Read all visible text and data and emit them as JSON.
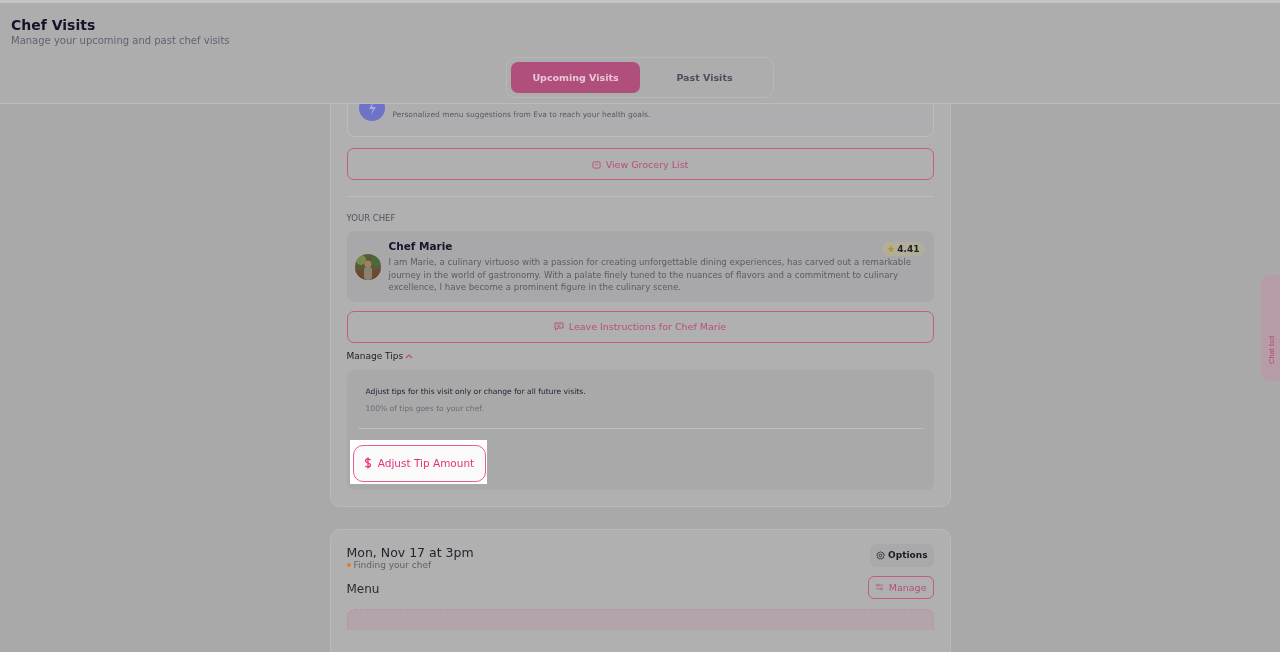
{
  "header": {
    "title": "Chef Visits",
    "subtitle": "Manage your upcoming and past chef visits"
  },
  "tabs": [
    {
      "label": "Upcoming Visits",
      "selected": true
    },
    {
      "label": "Past Visits",
      "selected": false
    }
  ],
  "visit": {
    "suggestion": "Personalized menu suggestions from Eva to reach your health goals.",
    "grocery_button": "View Grocery List",
    "section_label": "YOUR CHEF",
    "chef": {
      "name": "Chef Marie",
      "rating": "4.41",
      "bio": "I am Marie, a culinary virtuoso with a passion for creating unforgettable dining experiences, has carved out a remarkable journey in the world of gastronomy. With a palate finely tuned to the nuances of flavors and a commitment to culinary excellence, I have become a prominent figure in the culinary scene."
    },
    "instructions_button": "Leave Instructions for Chef Marie",
    "tips": {
      "label": "Manage Tips",
      "expanded": true,
      "note": "Adjust tips for this visit only or change for all future visits.",
      "subnote": "100% of tips goes to your chef.",
      "button": "Adjust Tip Amount"
    }
  },
  "next_visit": {
    "date": "Mon, Nov 17 at 3pm",
    "options_button": "Options",
    "status": {
      "label": "Finding your chef",
      "color": "#d9822b"
    },
    "menu_heading": "Menu",
    "manage_button": "Manage"
  },
  "chat_bot": "Chat bot"
}
